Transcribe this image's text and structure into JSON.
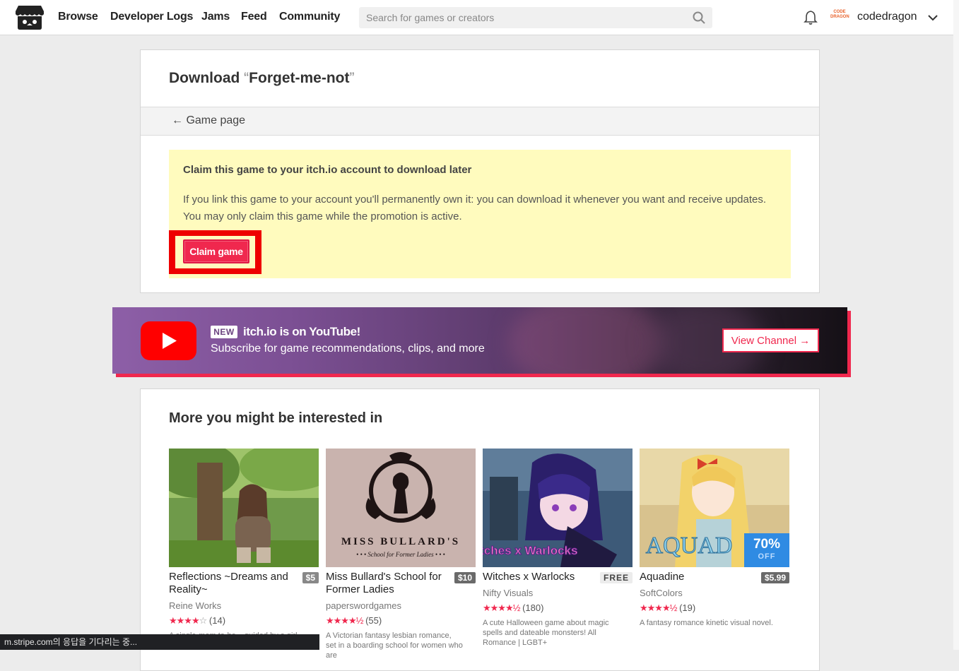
{
  "header": {
    "nav": [
      {
        "label": "Browse"
      },
      {
        "label": "Developer Logs"
      },
      {
        "label": "Jams"
      },
      {
        "label": "Feed"
      },
      {
        "label": "Community"
      }
    ],
    "search_placeholder": "Search for games or creators",
    "avatar_text": "CODE DRAGON",
    "username": "codedragon"
  },
  "download": {
    "title_prefix": "Download",
    "game_name": "Forget-me-not",
    "back_label": "← Game page",
    "claim_title": "Claim this game to your itch.io account to download later",
    "claim_desc": "If you link this game to your account you'll permanently own it: you can download it whenever you want and receive updates. You may only claim this game while the promotion is active.",
    "claim_button": "Claim game"
  },
  "youtube": {
    "badge": "NEW",
    "title": "itch.io is on YouTube!",
    "subtitle": "Subscribe for game recommendations, clips, and more",
    "button": "View Channel →"
  },
  "recommendations": {
    "heading": "More you might be interested in",
    "games": [
      {
        "title": "Reflections ~Dreams and Reality~",
        "price": "$5",
        "author": "Reine Works",
        "stars": "★★★★",
        "stars_off": "☆",
        "rating_count": "(14)",
        "description": "A single-mom to-be... guided by a girl..."
      },
      {
        "title": "Miss Bullard's School for Former Ladies",
        "price": "$10",
        "author": "paperswordgames",
        "stars": "★★★★",
        "stars_off": "½",
        "rating_count": "(55)",
        "description": "A Victorian fantasy lesbian romance, set in a boarding school for women who are",
        "thumb_title": "MISS BULLARD'S",
        "thumb_sub": "• • • School for Former Ladies • • •"
      },
      {
        "title": "Witches x Warlocks",
        "price": "FREE",
        "author": "Nifty Visuals",
        "stars": "★★★★",
        "stars_off": "½",
        "rating_count": "(180)",
        "description": "A cute Halloween game about magic spells and dateable monsters! All Romance | LGBT+",
        "thumb_title": "Witches x Warlocks"
      },
      {
        "title": "Aquadine",
        "price": "$5.99",
        "author": "SoftColors",
        "stars": "★★★★",
        "stars_off": "½",
        "rating_count": "(19)",
        "description": "A fantasy romance kinetic visual novel.",
        "thumb_title": "AQUAD",
        "sale_pct": "70%",
        "sale_off": "OFF"
      }
    ]
  },
  "status_bar": "m.stripe.com의 응답을 기다리는 중...",
  "colors": {
    "accent": "#f0284e",
    "claim_bg": "#fffbbe",
    "sale": "#2f8be3"
  }
}
